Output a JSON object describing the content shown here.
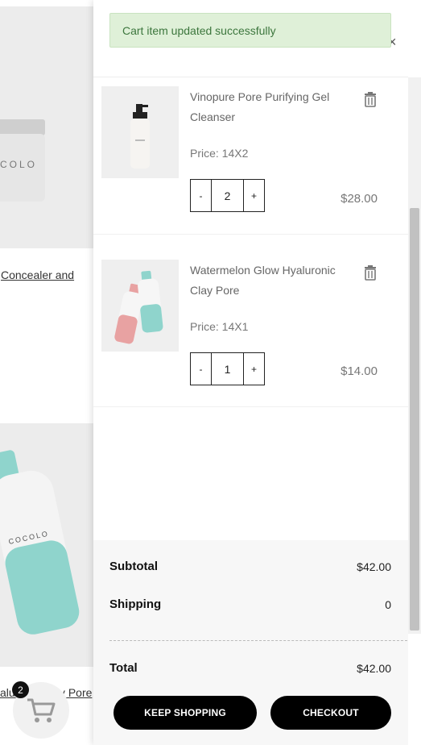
{
  "background": {
    "link1_text": "Concealer and",
    "link2_text": "aluronic Clay Pore",
    "cart_count": "2",
    "card1_brand": "COLO",
    "card2_brand": "COCOLO"
  },
  "cart": {
    "toast_message": "Cart item updated successfully",
    "close_label": "×",
    "items": [
      {
        "name": "Vinopure Pore Purifying Gel Cleanser",
        "price_label": "Price: 14X2",
        "quantity": "2",
        "line_total": "$28.00",
        "minus_label": "-",
        "plus_label": "+"
      },
      {
        "name": "Watermelon Glow Hyaluronic Clay Pore",
        "price_label": "Price: 14X1",
        "quantity": "1",
        "line_total": "$14.00",
        "minus_label": "-",
        "plus_label": "+"
      }
    ],
    "summary": {
      "subtotal_label": "Subtotal",
      "subtotal_value": "$42.00",
      "shipping_label": "Shipping",
      "shipping_value": "0",
      "total_label": "Total",
      "total_value": "$42.00"
    },
    "buttons": {
      "keep_shopping": "KEEP SHOPPING",
      "checkout": "CHECKOUT"
    }
  },
  "colors": {
    "toast_bg": "#dff0d8",
    "toast_text": "#3c763d",
    "button_bg": "#000000"
  }
}
